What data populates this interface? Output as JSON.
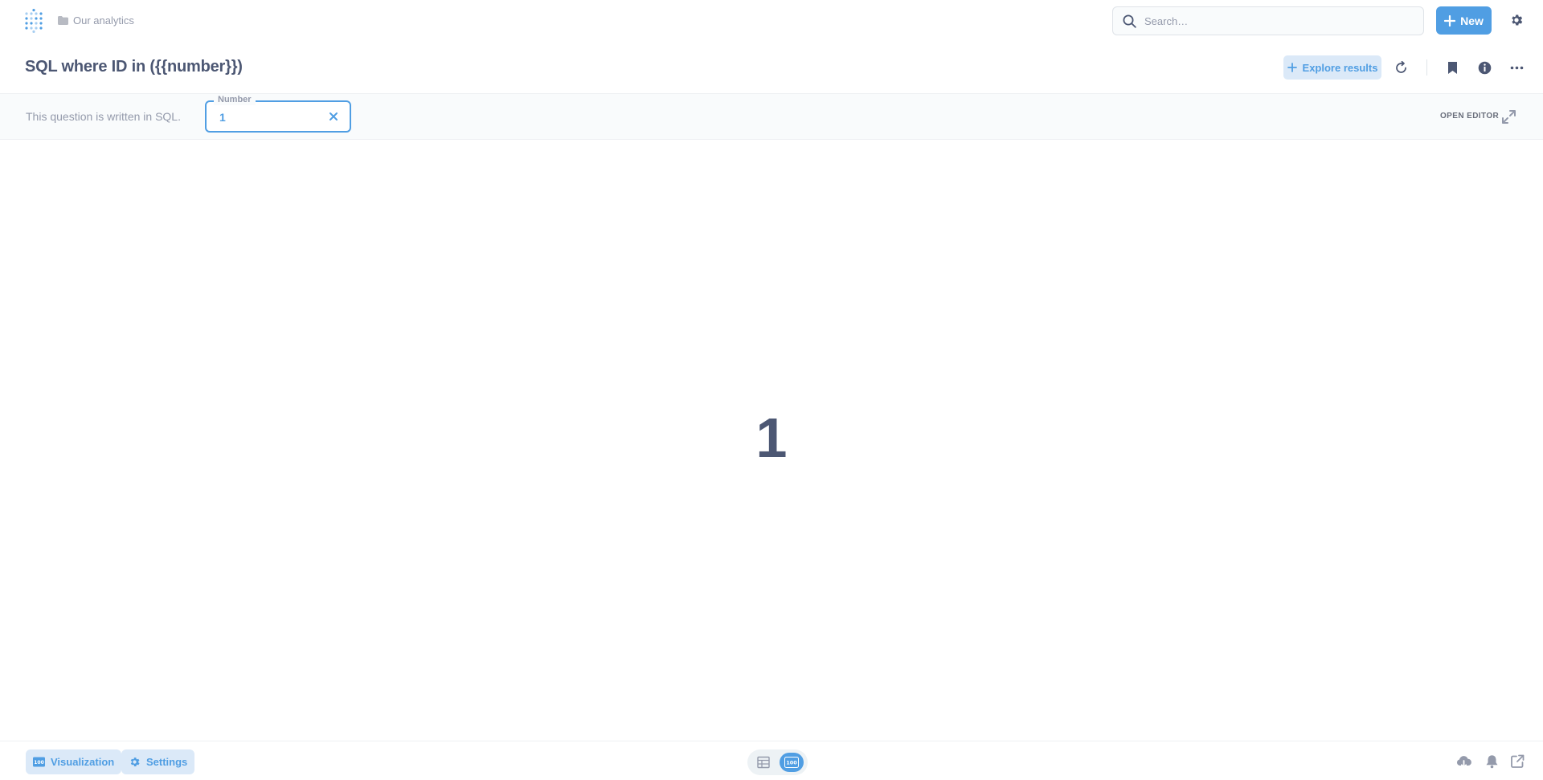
{
  "nav": {
    "breadcrumb": "Our analytics",
    "search_placeholder": "Search…",
    "new_label": "New"
  },
  "header": {
    "title": "SQL where ID in ({{number}})",
    "explore_label": "Explore results"
  },
  "param_bar": {
    "note": "This question is written in SQL.",
    "param_label": "Number",
    "param_value": "1",
    "open_editor_label": "OPEN EDITOR"
  },
  "result": {
    "value": "1"
  },
  "footer": {
    "visualization_label": "Visualization",
    "settings_label": "Settings",
    "toggle_badge": "100"
  },
  "colors": {
    "brand": "#509ee3",
    "brand_light": "#dbe9f8",
    "text_dark": "#4c5773",
    "text_light": "#949aab"
  },
  "icons": {
    "logo": "metabase-logo-icon",
    "breadcrumb": "folder-icon",
    "search": "search-icon",
    "new": "plus-icon",
    "admin": "gear-icon",
    "refresh": "refresh-icon",
    "bookmark": "bookmark-icon",
    "info": "info-icon",
    "more": "ellipsis-icon",
    "clear": "close-icon",
    "expand": "expand-icon",
    "table": "table-icon",
    "download": "cloud-download-icon",
    "alert": "bell-icon",
    "share": "external-link-icon"
  }
}
